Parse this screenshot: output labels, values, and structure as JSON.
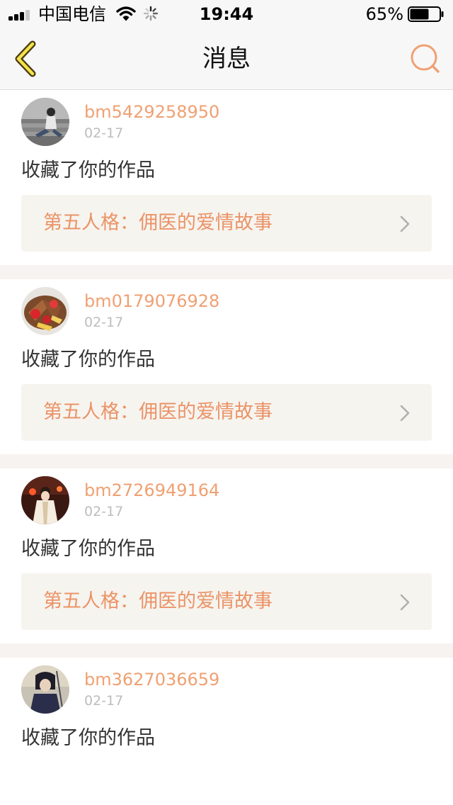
{
  "status_bar": {
    "carrier": "中国电信",
    "time": "19:44",
    "battery_percent": "65%",
    "battery_level": 0.65
  },
  "nav": {
    "title": "消息",
    "back_icon": "chevron-left-icon",
    "search_icon": "search-icon",
    "accent_color": "#f0a072"
  },
  "messages": [
    {
      "username": "bm5429258950",
      "date": "02-17",
      "action": "收藏了你的作品",
      "work_title": "第五人格：佣医的爱情故事"
    },
    {
      "username": "bm0179076928",
      "date": "02-17",
      "action": "收藏了你的作品",
      "work_title": "第五人格：佣医的爱情故事"
    },
    {
      "username": "bm2726949164",
      "date": "02-17",
      "action": "收藏了你的作品",
      "work_title": "第五人格：佣医的爱情故事"
    },
    {
      "username": "bm3627036659",
      "date": "02-17",
      "action": "收藏了你的作品",
      "work_title": ""
    }
  ]
}
